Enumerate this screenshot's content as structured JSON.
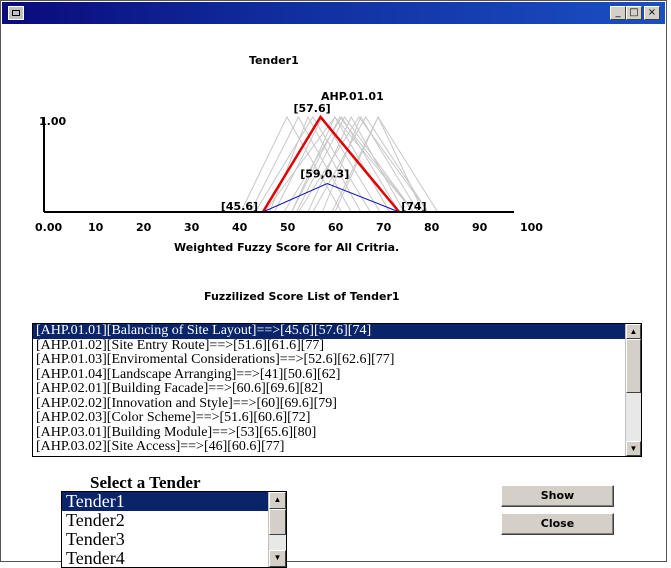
{
  "window": {
    "min_glyph": "_",
    "max_glyph": "□",
    "close_glyph": "×"
  },
  "chart_data": {
    "type": "line",
    "title": "Tender1",
    "subtitle": "AHP.01.01",
    "xlabel": "Weighted Fuzzy Score for All Critria.",
    "ylabel": "",
    "x_ticks": [
      "0.00",
      "10",
      "20",
      "30",
      "40",
      "50",
      "60",
      "70",
      "80",
      "90",
      "100"
    ],
    "y_tick": "1.00",
    "xlim": [
      0,
      100
    ],
    "ylim": [
      0,
      1
    ],
    "annotations": [
      "[57.6]",
      "[59,0.3]",
      "[45.6]",
      "[74]"
    ],
    "series": [
      {
        "color": "#e00000",
        "points": [
          [
            45.6,
            0
          ],
          [
            57.6,
            1
          ],
          [
            74,
            0
          ]
        ]
      },
      {
        "color": "#1010c0",
        "points": [
          [
            45.6,
            0
          ],
          [
            59,
            0.3
          ],
          [
            74,
            0
          ]
        ]
      }
    ],
    "background_triangles": [
      [
        51.6,
        61.6,
        77
      ],
      [
        52.6,
        62.6,
        77
      ],
      [
        41,
        50.6,
        62
      ],
      [
        60.6,
        69.6,
        82
      ],
      [
        60,
        69.6,
        79
      ],
      [
        51.6,
        60.6,
        72
      ],
      [
        53,
        65.6,
        80
      ],
      [
        46,
        60.6,
        77
      ],
      [
        48,
        58,
        70
      ],
      [
        55,
        64,
        75
      ],
      [
        44,
        56,
        68
      ],
      [
        58,
        66,
        78
      ],
      [
        50,
        62,
        74
      ],
      [
        47,
        55,
        66
      ],
      [
        56,
        67,
        80
      ],
      [
        43,
        53,
        64
      ]
    ],
    "background_color": "#c8c8c8"
  },
  "score_list": {
    "title": "Fuzzilized Score List of Tender1",
    "items": [
      "[AHP.01.01][Balancing of Site Layout]==>[45.6][57.6][74]",
      "[AHP.01.02][Site Entry Route]==>[51.6][61.6][77]",
      "[AHP.01.03][Enviromental Considerations]==>[52.6][62.6][77]",
      "[AHP.01.04][Landscape Arranging]==>[41][50.6][62]",
      "[AHP.02.01][Building Facade]==>[60.6][69.6][82]",
      "[AHP.02.02][Innovation and Style]==>[60][69.6][79]",
      "[AHP.02.03][Color Scheme]==>[51.6][60.6][72]",
      "[AHP.03.01][Building Module]==>[53][65.6][80]",
      "[AHP.03.02][Site Access]==>[46][60.6][77]"
    ],
    "selected_index": 0,
    "up_arrow": "▲",
    "down_arrow": "▼"
  },
  "tender_select": {
    "title": "Select a Tender",
    "items": [
      "Tender1",
      "Tender2",
      "Tender3",
      "Tender4"
    ],
    "selected_index": 0,
    "up_arrow": "▲",
    "down_arrow": "▼"
  },
  "buttons": {
    "show": "Show",
    "close": "Close"
  }
}
